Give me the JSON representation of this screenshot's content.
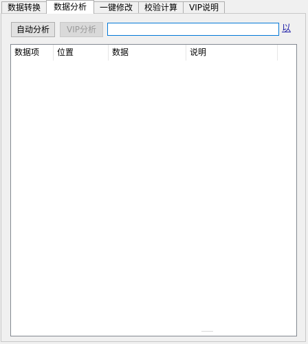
{
  "tabs": [
    {
      "label": "数据转换"
    },
    {
      "label": "数据分析"
    },
    {
      "label": "一键修改"
    },
    {
      "label": "校验计算"
    },
    {
      "label": "VIP说明"
    }
  ],
  "toolbar": {
    "auto_analyze_label": "自动分析",
    "vip_analyze_label": "VIP分析",
    "input_value": "",
    "link_glyph": "以"
  },
  "list": {
    "columns": [
      "数据项",
      "位置",
      "数据",
      "说明"
    ]
  }
}
